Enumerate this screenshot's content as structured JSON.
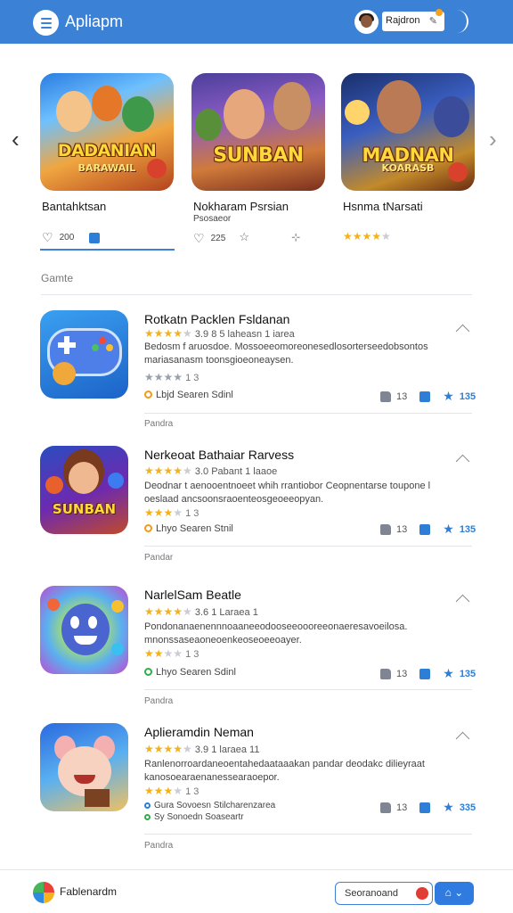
{
  "header": {
    "app_title": "Apliapm",
    "user_name": "Rajdron",
    "user_edit": "✎"
  },
  "carousel": {
    "prev_arrow": "‹",
    "next_arrow": "›",
    "cards": [
      {
        "logo_main": "DADANIAN",
        "logo_sub": "BARAWAIL",
        "title": "Bantahktsan",
        "subtitle": "",
        "heart": "♡",
        "count": "200",
        "rating": null
      },
      {
        "logo_main": "SUNBAN",
        "logo_sub": "",
        "title": "Nokharam Psrsian",
        "subtitle": "Psosaeor",
        "heart": "♡",
        "count": "225",
        "rating": null,
        "extra": "☆",
        "extra2": "⊹"
      },
      {
        "logo_main": "MADNAN",
        "logo_sub": "KOARASB",
        "title": "Hsnma tNarsati",
        "subtitle": "",
        "rating": 4
      }
    ]
  },
  "section": {
    "label": "Gamte"
  },
  "list": [
    {
      "title": "Rotkatn Packlen Fsldanan",
      "rating_text": "3.9 8 5 laheasn 1 iarea",
      "desc": "Bedosm f aruosdoe. Mossoeeomoreonesedlosorterseedobsontos mariasanasm toonsgioeoneaysen.",
      "sub_rating": "1 3",
      "developer": "Lbjd Searen Sdinl",
      "likes": "13",
      "stars": "135",
      "footer": "Pandra"
    },
    {
      "title": "Nerkeoat Bathaiar Rarvess",
      "rating_text": "3.0 Pabant 1 laaoe",
      "desc": "Deodnar t aenooentnoeet whih rrantiobor Ceopnentarse toupone l oeslaad ancsoonsraoenteosgeoeeopyan.",
      "sub_rating": "1 3",
      "developer": "Lhyo Searen Stnil",
      "likes": "13",
      "stars": "135",
      "footer": "Pandar"
    },
    {
      "title": "NarlelSam Beatle",
      "rating_text": "3.6 1 Laraea 1",
      "desc": "Pondonanaenennnoaaneeodooseeoooreeonaeresavoeilosa. mnonssaseaoneoenkeoseoeeoayer.",
      "sub_rating": "1 3",
      "developer": "Lhyo Searen Sdinl",
      "likes": "13",
      "stars": "135",
      "footer": "Pandra"
    },
    {
      "title": "Aplieramdin Neman",
      "rating_text": "3.9 1 laraea 11",
      "desc": "Ranlenorroardaneoentahedaataaakan pandar deodakc dilieyraat kanosoearaenanessearaoepor.",
      "sub_rating": "1 3",
      "developer": "Gura Sovoesn Stilcharenzarea",
      "developer2": "Sy Sonoedn Soaseartr",
      "likes": "13",
      "stars": "335",
      "footer": "Pandra"
    }
  ],
  "bottom_bar": {
    "label": "Fablenardm",
    "input_value": "Seoranoand",
    "button_label": "⌂ ⌄"
  },
  "colors": {
    "accent": "#3b82d6",
    "star": "#f3b21c",
    "action_blue": "#2d7ed6"
  }
}
